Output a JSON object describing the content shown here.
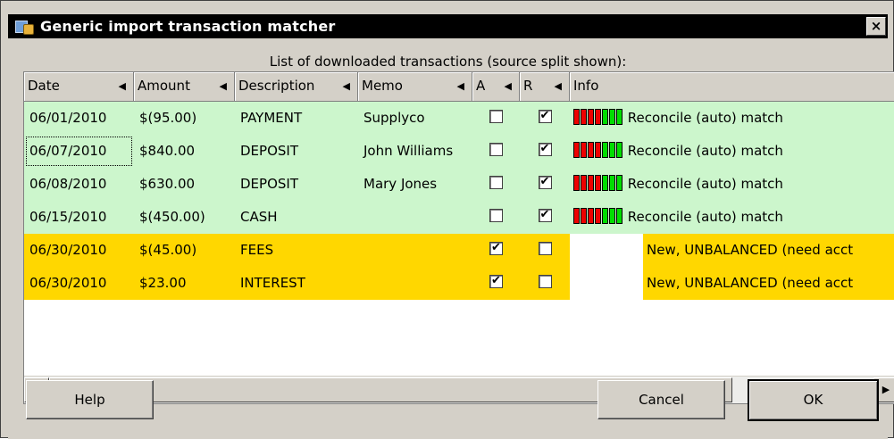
{
  "window": {
    "title": "Generic import transaction matcher",
    "close_glyph": "×"
  },
  "list_caption": "List of downloaded transactions (source split shown):",
  "columns": [
    {
      "label": "Date"
    },
    {
      "label": "Amount"
    },
    {
      "label": "Description"
    },
    {
      "label": "Memo"
    },
    {
      "label": "A"
    },
    {
      "label": "R"
    },
    {
      "label": "Info"
    }
  ],
  "rows": [
    {
      "date": "06/01/2010",
      "amount": "$(95.00)",
      "description": "PAYMENT",
      "memo": "Supplyco",
      "a": "",
      "r": "✔",
      "info": "Reconcile (auto) match",
      "status": "matched"
    },
    {
      "date": "06/07/2010",
      "amount": "$840.00",
      "description": "DEPOSIT",
      "memo": "John Williams",
      "a": "",
      "r": "✔",
      "info": "Reconcile (auto) match",
      "status": "matched"
    },
    {
      "date": "06/08/2010",
      "amount": "$630.00",
      "description": "DEPOSIT",
      "memo": "Mary Jones",
      "a": "",
      "r": "✔",
      "info": "Reconcile (auto) match",
      "status": "matched"
    },
    {
      "date": "06/15/2010",
      "amount": "$(450.00)",
      "description": "CASH",
      "memo": "",
      "a": "",
      "r": "✔",
      "info": "Reconcile (auto) match",
      "status": "matched"
    },
    {
      "date": "06/30/2010",
      "amount": "$(45.00)",
      "description": "FEES",
      "memo": "",
      "a": "✔",
      "r": "",
      "info": "New, UNBALANCED (need acct",
      "status": "new"
    },
    {
      "date": "06/30/2010",
      "amount": "$23.00",
      "description": "INTEREST",
      "memo": "",
      "a": "✔",
      "r": "",
      "info": "New, UNBALANCED (need acct",
      "status": "new"
    }
  ],
  "match_score": {
    "red_bars": 4,
    "green_bars": 3
  },
  "buttons": {
    "help": "Help",
    "cancel": "Cancel",
    "ok": "OK"
  },
  "colors": {
    "matched_row": "#ccf6cc",
    "new_row": "#ffd700",
    "score_red": "#ee0000",
    "score_green": "#00dd00"
  }
}
